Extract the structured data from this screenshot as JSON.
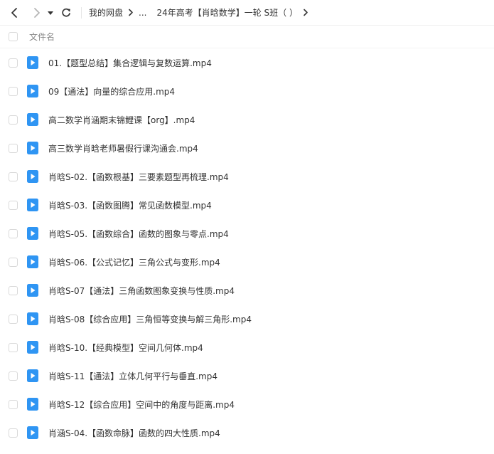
{
  "toolbar": {
    "breadcrumbs": [
      {
        "label": "我的网盘"
      },
      {
        "label": "..."
      },
      {
        "label": "24年高考【肖晗数学】一轮 S班（  ）"
      }
    ]
  },
  "list": {
    "column_header": "文件名",
    "files": [
      {
        "name": "01.【题型总结】集合逻辑与复数运算.mp4"
      },
      {
        "name": "09【通法】向量的综合应用.mp4"
      },
      {
        "name": "高二数学肖涵期末锦鲤课【org】.mp4"
      },
      {
        "name": "高三数学肖晗老师暑假行课沟通会.mp4"
      },
      {
        "name": "肖晗S-02.【函数根基】三要素题型再梳理.mp4"
      },
      {
        "name": "肖晗S-03.【函数图腾】常见函数模型.mp4"
      },
      {
        "name": "肖晗S-05.【函数综合】函数的图象与零点.mp4"
      },
      {
        "name": "肖晗S-06.【公式记忆】三角公式与变形.mp4"
      },
      {
        "name": "肖晗S-07【通法】三角函数图象变换与性质.mp4"
      },
      {
        "name": "肖晗S-08【综合应用】三角恒等变换与解三角形.mp4"
      },
      {
        "name": "肖晗S-10.【经典模型】空间几何体.mp4"
      },
      {
        "name": "肖晗S-11【通法】立体几何平行与垂直.mp4"
      },
      {
        "name": "肖晗S-12【综合应用】空间中的角度与距离.mp4"
      },
      {
        "name": "肖涵S-04.【函数命脉】函数的四大性质.mp4"
      }
    ]
  },
  "icons": {
    "back": "chevron-left-icon",
    "forward": "chevron-right-icon",
    "history": "caret-down-icon",
    "refresh": "refresh-icon",
    "crumb_separator": "chevron-right-icon",
    "file": "video-file-icon"
  },
  "colors": {
    "accent": "#2f95f3",
    "checkbox_border": "#d9d9d9",
    "header_text": "#888888",
    "text": "#333333"
  }
}
